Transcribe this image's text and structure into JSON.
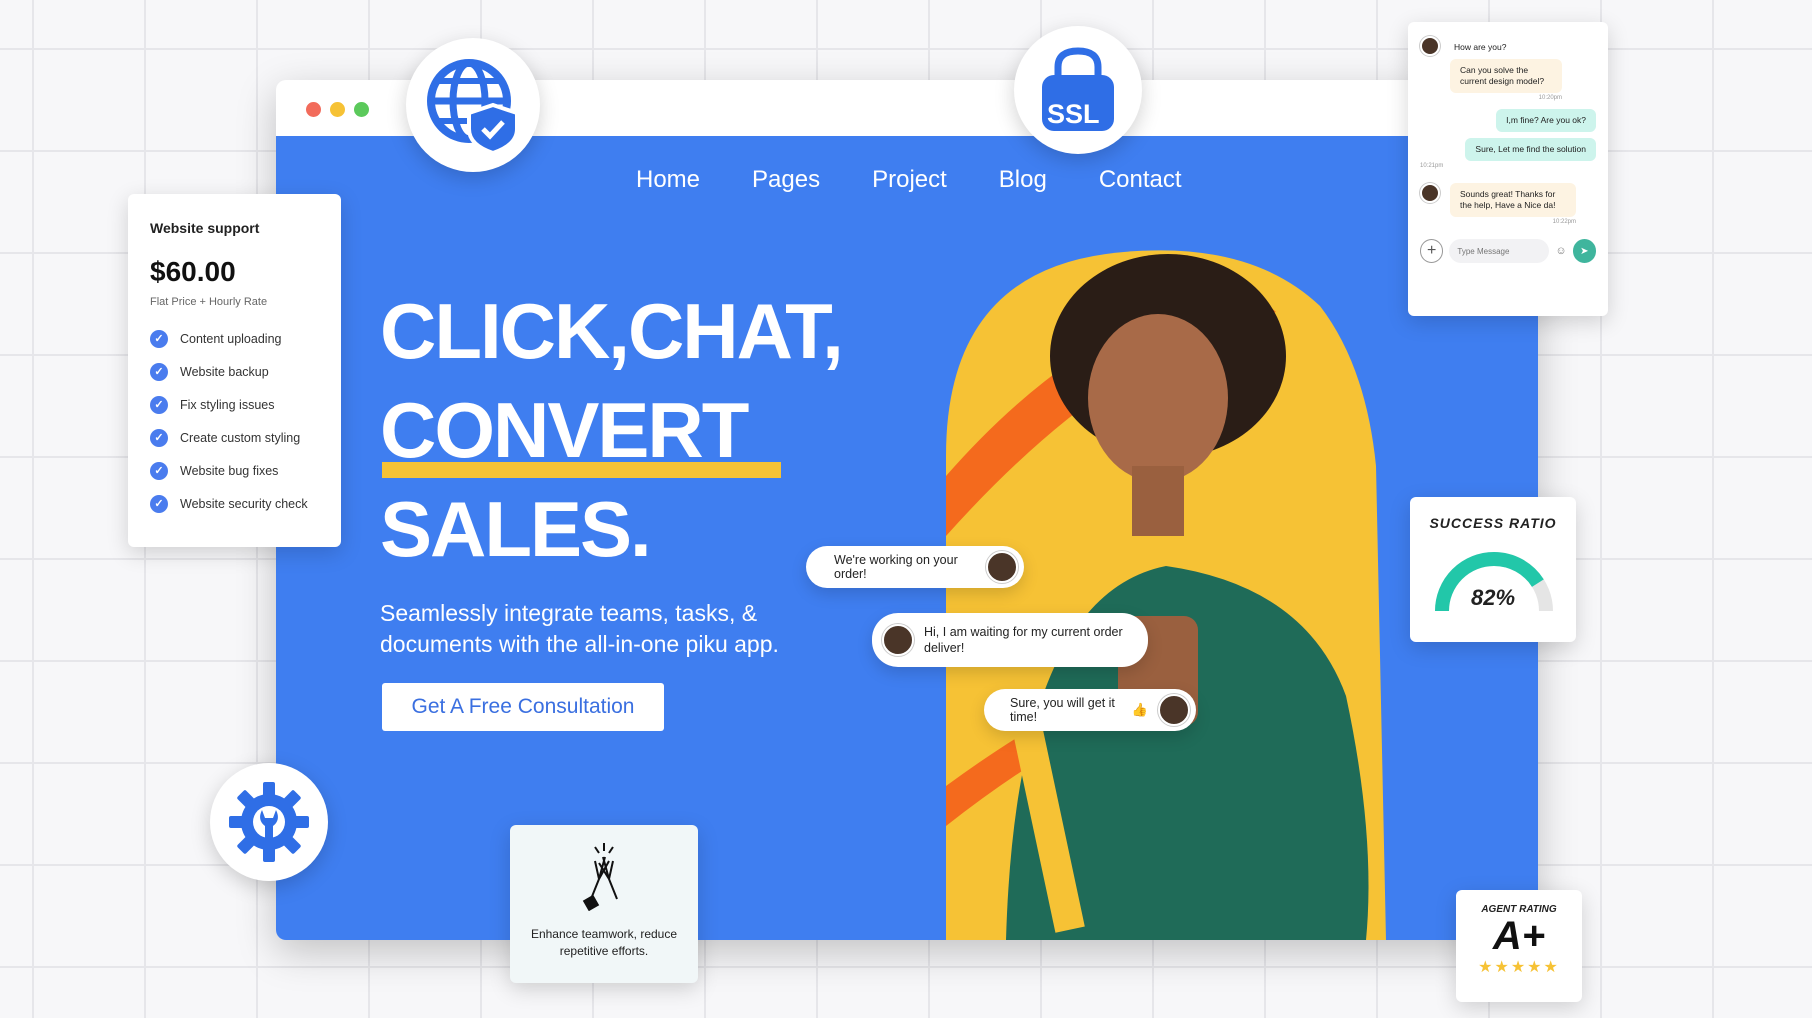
{
  "browser": {
    "nav": [
      "Home",
      "Pages",
      "Project",
      "Blog",
      "Contact"
    ],
    "dot_colors": [
      "#f26b5b",
      "#f6c235",
      "#5bc95b"
    ]
  },
  "hero": {
    "headline": [
      "CLICK,CHAT,",
      "CONVERT",
      "SALES."
    ],
    "subtitle": "Seamlessly integrate teams, tasks, & documents with the all-in-one piku app.",
    "cta": "Get A Free Consultation",
    "accent": "#f6c235",
    "bg": "#3f7ef0"
  },
  "chat_bubbles": {
    "b1": "We're working on your order!",
    "b2": "Hi, I am waiting for my current order deliver!",
    "b3": "Sure, you will get it time!"
  },
  "pricing": {
    "title": "Website support",
    "price": "$60.00",
    "rate": "Flat Price + Hourly Rate",
    "features": [
      "Content uploading",
      "Website backup",
      "Fix styling issues",
      "Create custom styling",
      "Website bug fixes",
      "Website security check"
    ]
  },
  "badges": {
    "ssl": "SSL"
  },
  "chat_panel": {
    "m1": "How are you?",
    "m2": "Can you solve  the current design model?",
    "t1": "10:20pm",
    "m3": "I,m fine? Are you ok?",
    "m4": "Sure, Let me find the solution",
    "t2": "10:21pm",
    "m5": "Sounds great! Thanks for the help, Have a Nice da!",
    "t3": "10:22pm",
    "input_placeholder": "Type Message"
  },
  "success": {
    "title": "SUCCESS RATIO",
    "value": "82%",
    "ratio": 0.82
  },
  "rating": {
    "title": "AGENT RATING",
    "grade": "A+",
    "stars": 5
  },
  "teamwork": {
    "caption": "Enhance teamwork, reduce repetitive efforts."
  }
}
